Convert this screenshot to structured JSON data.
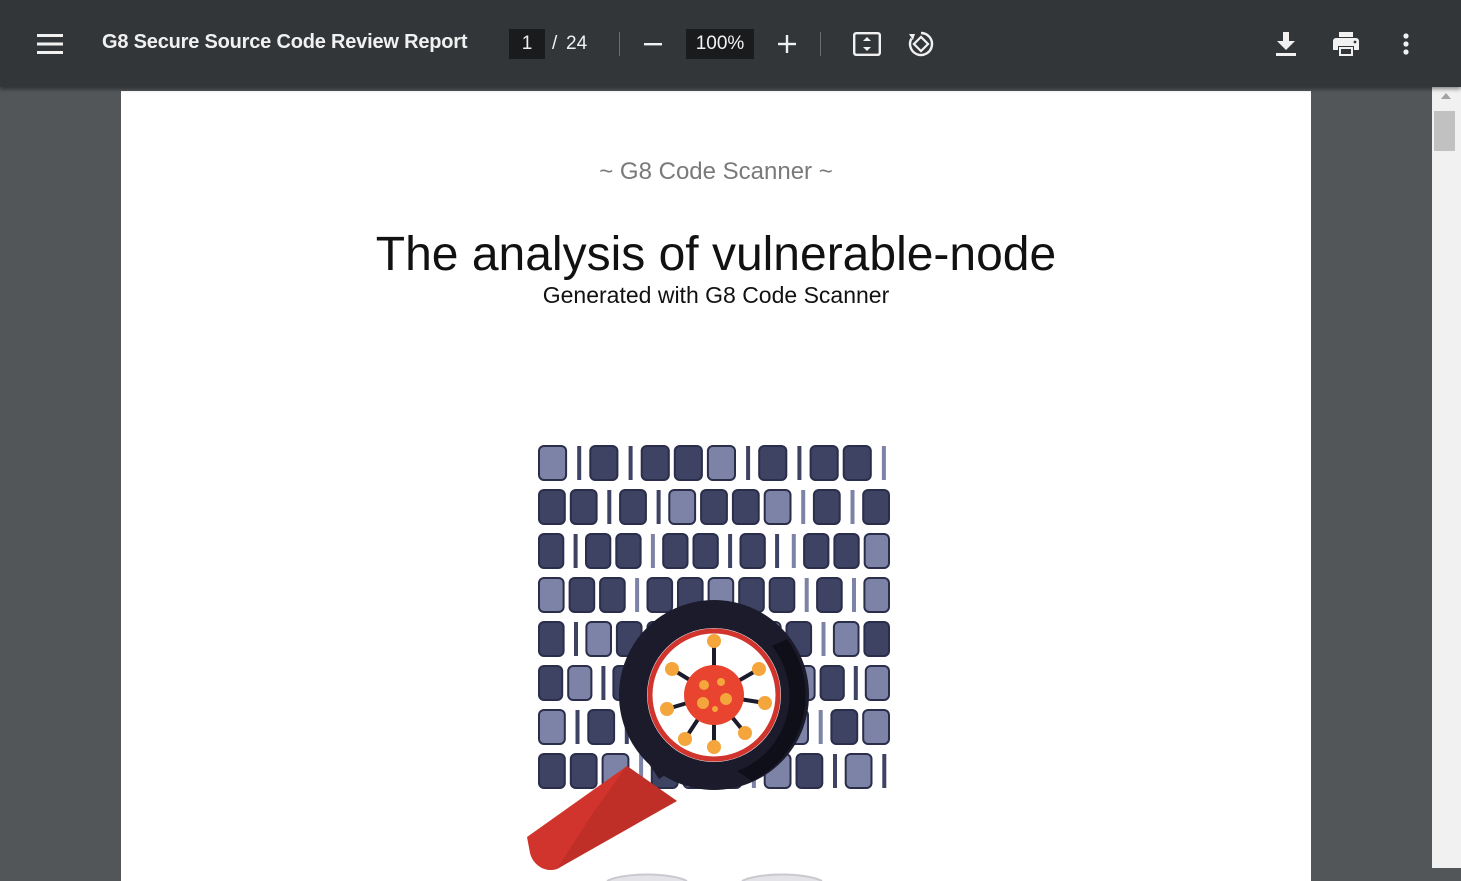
{
  "toolbar": {
    "title": "G8 Secure Source Code Review Report",
    "page_current": "1",
    "page_separator": "/",
    "page_total": "24",
    "zoom": "100%",
    "icons": [
      "menu-icon",
      "minus-icon",
      "plus-icon",
      "fit-page-icon",
      "rotate-icon",
      "download-icon",
      "print-icon",
      "more-vert-icon"
    ]
  },
  "document": {
    "scanner_banner": "~ G8 Code Scanner ~",
    "title": "The analysis of vulnerable-node",
    "generated_with": "Generated with G8 Code Scanner",
    "illustration": "magnifier-over-binary-code-with-virus",
    "binary_rows": [
      "0101000101001",
      "0010100001010",
      "01001001011000",
      "0001000001010",
      "0100001000100",
      "00100010100010",
      "0101000100100",
      "0001000100101"
    ]
  },
  "colors": {
    "toolbar_bg": "#323639",
    "viewer_bg": "#525659",
    "page_bg": "#ffffff",
    "input_bg": "#191b1c",
    "magnifier_handle": "#d0342c",
    "virus": "#e8442f"
  }
}
